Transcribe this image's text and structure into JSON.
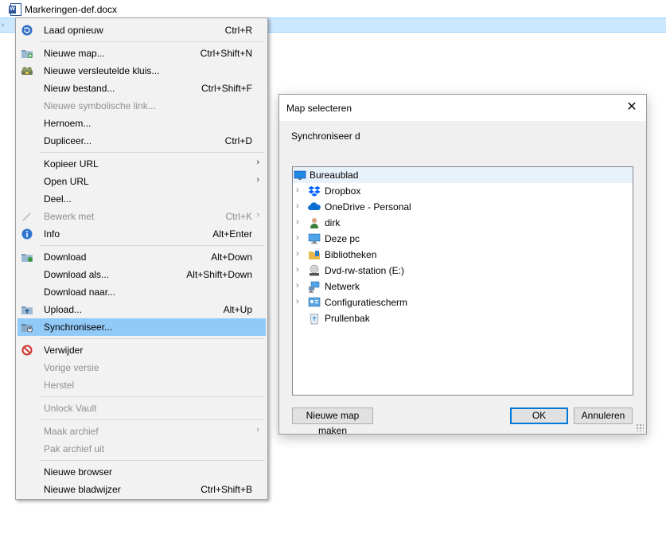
{
  "background": {
    "file_name": "Markeringen-def.docx"
  },
  "context_menu": {
    "items": [
      {
        "label": "Laad opnieuw",
        "shortcut": "Ctrl+R",
        "icon": "refresh-icon"
      },
      {
        "label": "Nieuwe map...",
        "shortcut": "Ctrl+Shift+N",
        "icon": "new-folder-icon"
      },
      {
        "label": "Nieuwe versleutelde kluis...",
        "shortcut": "",
        "icon": "vault-icon"
      },
      {
        "label": "Nieuw bestand...",
        "shortcut": "Ctrl+Shift+F"
      },
      {
        "label": "Nieuwe symbolische link...",
        "shortcut": "",
        "disabled": true
      },
      {
        "label": "Hernoem...",
        "shortcut": ""
      },
      {
        "label": "Dupliceer...",
        "shortcut": "Ctrl+D"
      },
      {
        "label": "Kopieer URL",
        "shortcut": "",
        "submenu": true
      },
      {
        "label": "Open URL",
        "shortcut": "",
        "submenu": true
      },
      {
        "label": "Deel...",
        "shortcut": ""
      },
      {
        "label": "Bewerk met",
        "shortcut": "Ctrl+K",
        "submenu": true,
        "disabled": true,
        "icon": "pencil-icon"
      },
      {
        "label": "Info",
        "shortcut": "Alt+Enter",
        "icon": "info-icon"
      },
      {
        "label": "Download",
        "shortcut": "Alt+Down",
        "icon": "download-icon"
      },
      {
        "label": "Download als...",
        "shortcut": "Alt+Shift+Down"
      },
      {
        "label": "Download naar...",
        "shortcut": ""
      },
      {
        "label": "Upload...",
        "shortcut": "Alt+Up",
        "icon": "upload-icon"
      },
      {
        "label": "Synchroniseer...",
        "shortcut": "",
        "icon": "sync-icon",
        "highlighted": true
      },
      {
        "label": "Verwijder",
        "shortcut": "",
        "icon": "delete-icon"
      },
      {
        "label": "Vorige versie",
        "shortcut": "",
        "disabled": true
      },
      {
        "label": "Herstel",
        "shortcut": "",
        "disabled": true
      },
      {
        "label": "Unlock Vault",
        "shortcut": "",
        "disabled": true
      },
      {
        "label": "Maak archief",
        "shortcut": "",
        "submenu": true,
        "disabled": true
      },
      {
        "label": "Pak archief uit",
        "shortcut": "",
        "disabled": true
      },
      {
        "label": "Nieuwe browser",
        "shortcut": ""
      },
      {
        "label": "Nieuwe bladwijzer",
        "shortcut": "Ctrl+Shift+B"
      }
    ]
  },
  "dialog": {
    "title": "Map selecteren",
    "description": "Synchroniseer d",
    "tree": [
      {
        "label": "Bureaublad",
        "icon": "desktop-icon",
        "root": true
      },
      {
        "label": "Dropbox",
        "icon": "dropbox-icon"
      },
      {
        "label": "OneDrive - Personal",
        "icon": "onedrive-icon"
      },
      {
        "label": "dirk",
        "icon": "user-icon"
      },
      {
        "label": "Deze pc",
        "icon": "computer-icon"
      },
      {
        "label": "Bibliotheken",
        "icon": "library-icon"
      },
      {
        "label": "Dvd-rw-station (E:)",
        "icon": "dvd-drive-icon"
      },
      {
        "label": "Netwerk",
        "icon": "network-icon"
      },
      {
        "label": "Configuratiescherm",
        "icon": "control-panel-icon"
      },
      {
        "label": "Prullenbak",
        "icon": "recycle-bin-icon",
        "no_expand": true
      }
    ],
    "buttons": {
      "new_folder": "Nieuwe map maken",
      "ok": "OK",
      "cancel": "Annuleren"
    }
  }
}
